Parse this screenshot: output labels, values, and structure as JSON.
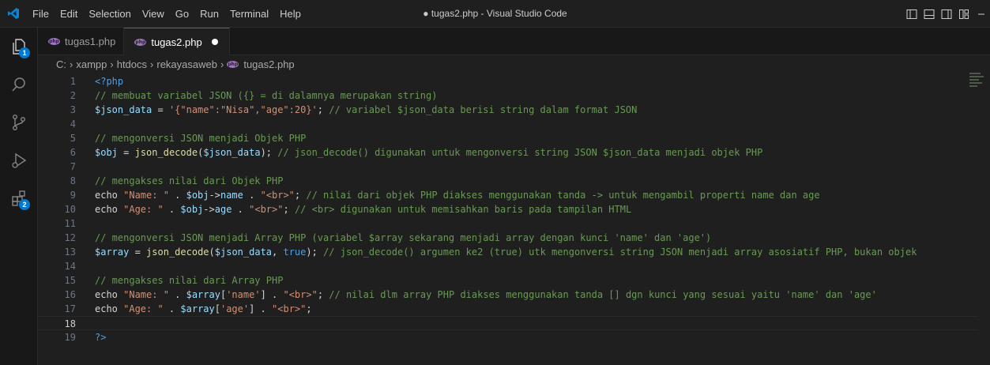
{
  "titlebar": {
    "menu": [
      "File",
      "Edit",
      "Selection",
      "View",
      "Go",
      "Run",
      "Terminal",
      "Help"
    ],
    "window_title": "● tugas2.php - Visual Studio Code"
  },
  "activity_bar": {
    "explorer_badge": "1",
    "extensions_badge": "2"
  },
  "tabs": [
    {
      "label": "tugas1.php",
      "active": false
    },
    {
      "label": "tugas2.php",
      "active": true,
      "dirty": true
    }
  ],
  "breadcrumb": [
    "C:",
    "xampp",
    "htdocs",
    "rekayasaweb",
    "tugas2.php"
  ],
  "editor": {
    "current_line": 18,
    "lines": [
      {
        "n": "1",
        "tokens": [
          [
            "php",
            "<?php"
          ]
        ]
      },
      {
        "n": "2",
        "tokens": [
          [
            "comment",
            "// membuat variabel JSON ({} = di dalamnya merupakan string)"
          ]
        ]
      },
      {
        "n": "3",
        "tokens": [
          [
            "var",
            "$json_data"
          ],
          [
            "op",
            " = "
          ],
          [
            "string",
            "'{\"name\":\"Nisa\",\"age\":20}'"
          ],
          [
            "op",
            "; "
          ],
          [
            "comment",
            "// variabel $json_data berisi string dalam format JSON"
          ]
        ]
      },
      {
        "n": "4",
        "tokens": []
      },
      {
        "n": "5",
        "tokens": [
          [
            "comment",
            "// mengonversi JSON menjadi Objek PHP"
          ]
        ]
      },
      {
        "n": "6",
        "tokens": [
          [
            "var",
            "$obj"
          ],
          [
            "op",
            " = "
          ],
          [
            "func",
            "json_decode"
          ],
          [
            "op",
            "("
          ],
          [
            "var",
            "$json_data"
          ],
          [
            "op",
            "); "
          ],
          [
            "comment",
            "// json_decode() digunakan untuk mengonversi string JSON $json_data menjadi objek PHP"
          ]
        ]
      },
      {
        "n": "7",
        "tokens": []
      },
      {
        "n": "8",
        "tokens": [
          [
            "comment",
            "// mengakses nilai dari Objek PHP"
          ]
        ]
      },
      {
        "n": "9",
        "tokens": [
          [
            "plain",
            "echo "
          ],
          [
            "string",
            "\"Name: \""
          ],
          [
            "op",
            " . "
          ],
          [
            "var",
            "$obj"
          ],
          [
            "op",
            "->"
          ],
          [
            "var",
            "name"
          ],
          [
            "op",
            " . "
          ],
          [
            "string",
            "\"<br>\""
          ],
          [
            "op",
            "; "
          ],
          [
            "comment",
            "// nilai dari objek PHP diakses menggunakan tanda -> untuk mengambil properti name dan age"
          ]
        ]
      },
      {
        "n": "10",
        "tokens": [
          [
            "plain",
            "echo "
          ],
          [
            "string",
            "\"Age: \""
          ],
          [
            "op",
            " . "
          ],
          [
            "var",
            "$obj"
          ],
          [
            "op",
            "->"
          ],
          [
            "var",
            "age"
          ],
          [
            "op",
            " . "
          ],
          [
            "string",
            "\"<br>\""
          ],
          [
            "op",
            "; "
          ],
          [
            "comment",
            "// <br> digunakan untuk memisahkan baris pada tampilan HTML"
          ]
        ]
      },
      {
        "n": "11",
        "tokens": []
      },
      {
        "n": "12",
        "tokens": [
          [
            "comment",
            "// mengonversi JSON menjadi Array PHP (variabel $array sekarang menjadi array dengan kunci 'name' dan 'age')"
          ]
        ]
      },
      {
        "n": "13",
        "tokens": [
          [
            "var",
            "$array"
          ],
          [
            "op",
            " = "
          ],
          [
            "func",
            "json_decode"
          ],
          [
            "op",
            "("
          ],
          [
            "var",
            "$json_data"
          ],
          [
            "op",
            ", "
          ],
          [
            "bool",
            "true"
          ],
          [
            "op",
            "); "
          ],
          [
            "comment",
            "// json_decode() argumen ke2 (true) utk mengonversi string JSON menjadi array asosiatif PHP, bukan objek"
          ]
        ]
      },
      {
        "n": "14",
        "tokens": []
      },
      {
        "n": "15",
        "tokens": [
          [
            "comment",
            "// mengakses nilai dari Array PHP"
          ]
        ]
      },
      {
        "n": "16",
        "tokens": [
          [
            "plain",
            "echo "
          ],
          [
            "string",
            "\"Name: \""
          ],
          [
            "op",
            " . "
          ],
          [
            "var",
            "$array"
          ],
          [
            "op",
            "["
          ],
          [
            "string",
            "'name'"
          ],
          [
            "op",
            "] . "
          ],
          [
            "string",
            "\"<br>\""
          ],
          [
            "op",
            "; "
          ],
          [
            "comment",
            "// nilai dlm array PHP diakses menggunakan tanda [] dgn kunci yang sesuai yaitu 'name' dan 'age'"
          ]
        ]
      },
      {
        "n": "17",
        "tokens": [
          [
            "plain",
            "echo "
          ],
          [
            "string",
            "\"Age: \""
          ],
          [
            "op",
            " . "
          ],
          [
            "var",
            "$array"
          ],
          [
            "op",
            "["
          ],
          [
            "string",
            "'age'"
          ],
          [
            "op",
            "] . "
          ],
          [
            "string",
            "\"<br>\""
          ],
          [
            "op",
            ";"
          ]
        ]
      },
      {
        "n": "18",
        "tokens": []
      },
      {
        "n": "19",
        "tokens": [
          [
            "php",
            "?>"
          ]
        ]
      }
    ]
  }
}
